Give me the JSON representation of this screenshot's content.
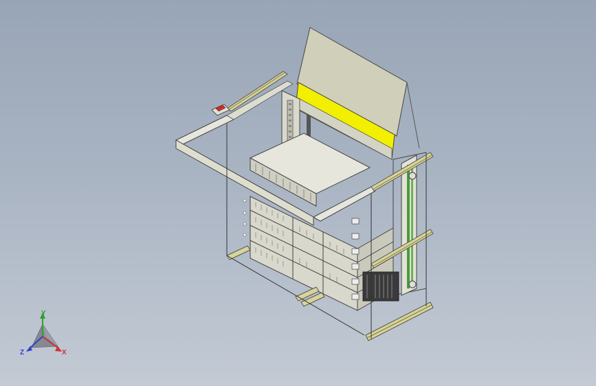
{
  "viewport": {
    "background_top": "#98a5b6",
    "background_bottom": "#c3cad4"
  },
  "model": {
    "frame_color": "#d6d6c6",
    "panel_color": "#cfcfbf",
    "highlight_color": "#f0ee00",
    "rail_color": "#b8b27a",
    "green_accent": "#4a9a3a",
    "red_tag": "#c8302a"
  },
  "triad": {
    "x_label": "X",
    "y_label": "Y",
    "z_label": "Z",
    "x_color": "#d03030",
    "y_color": "#30a030",
    "z_color": "#3040d0"
  }
}
